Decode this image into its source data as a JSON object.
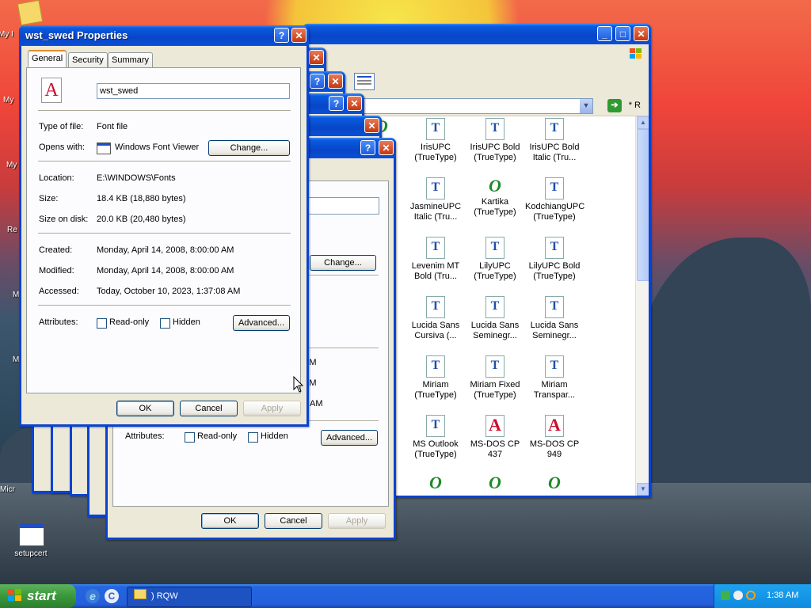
{
  "props": {
    "title": "wst_swed Properties",
    "tabs": [
      "General",
      "Security",
      "Summary"
    ],
    "filename": "wst_swed",
    "type_label": "Type of file:",
    "type_value": "Font file",
    "opens_label": "Opens with:",
    "opens_value": "Windows Font Viewer",
    "change_button": "Change...",
    "location_label": "Location:",
    "location_value": "E:\\WINDOWS\\Fonts",
    "size_label": "Size:",
    "size_value": "18.4 KB (18,880 bytes)",
    "size_disk_label": "Size on disk:",
    "size_disk_value": "20.0 KB (20,480 bytes)",
    "created_label": "Created:",
    "created_value": "Monday, April 14, 2008, 8:00:00 AM",
    "modified_label": "Modified:",
    "modified_value": "Monday, April 14, 2008, 8:00:00 AM",
    "accessed_label": "Accessed:",
    "accessed_value": "Today, October 10, 2023, 1:37:08 AM",
    "attributes_label": "Attributes:",
    "readonly_label": "Read-only",
    "hidden_label": "Hidden",
    "advanced_button": "Advanced...",
    "ok_button": "OK",
    "cancel_button": "Cancel",
    "apply_button": "Apply"
  },
  "back_dialog": {
    "change_button": "Change...",
    "attributes_label": "Attributes:",
    "readonly_label": "Read-only",
    "hidden_label": "Hidden",
    "advanced_button": "Advanced...",
    "ok_button": "OK",
    "cancel_button": "Cancel",
    "apply_button": "Apply",
    "time_suffix_1": "AM",
    "time_suffix_2": "AM",
    "time_suffix_3": "AM"
  },
  "fonts_window": {
    "address_suffix": "* R",
    "items": [
      {
        "icon": "opentype-font-icon",
        "glyph": "O",
        "label": "ect\nype)"
      },
      {
        "icon": "truetype-font-icon",
        "glyph": "T",
        "label": "IrisUPC\n(TrueType)"
      },
      {
        "icon": "truetype-font-icon",
        "glyph": "T",
        "label": "IrisUPC Bold\n(TrueType)"
      },
      {
        "icon": "truetype-font-icon",
        "glyph": "T",
        "label": "IrisUPC Bold\nItalic (Tru..."
      },
      {
        "icon": "truetype-font-icon",
        "glyph": "T",
        "label": "eUPC\nalic..."
      },
      {
        "icon": "truetype-font-icon",
        "glyph": "T",
        "label": "JasmineUPC\nItalic (Tru..."
      },
      {
        "icon": "opentype-font-icon",
        "glyph": "O",
        "label": "Kartika\n(TrueType)"
      },
      {
        "icon": "truetype-font-icon",
        "glyph": "T",
        "label": "KodchiangUPC\n(TrueType)"
      },
      {
        "icon": "truetype-font-icon",
        "glyph": "T",
        "label": "m MT\nype)"
      },
      {
        "icon": "truetype-font-icon",
        "glyph": "T",
        "label": "Levenim MT\nBold (Tru..."
      },
      {
        "icon": "truetype-font-icon",
        "glyph": "T",
        "label": "LilyUPC\n(TrueType)"
      },
      {
        "icon": "truetype-font-icon",
        "glyph": "T",
        "label": "LilyUPC Bold\n(TrueType)"
      },
      {
        "icon": "truetype-font-icon",
        "glyph": "T",
        "label": "Sans\nype)"
      },
      {
        "icon": "truetype-font-icon",
        "glyph": "T",
        "label": "Lucida Sans\nCursiva (..."
      },
      {
        "icon": "truetype-font-icon",
        "glyph": "T",
        "label": "Lucida Sans\nSeminegr..."
      },
      {
        "icon": "truetype-font-icon",
        "glyph": "T",
        "label": "Lucida Sans\nSeminegr..."
      },
      {
        "icon": "truetype-font-icon",
        "glyph": "T",
        "label": "iU &\niU..."
      },
      {
        "icon": "truetype-font-icon",
        "glyph": "T",
        "label": "Miriam\n(TrueType)"
      },
      {
        "icon": "truetype-font-icon",
        "glyph": "T",
        "label": "Miriam Fixed\n(TrueType)"
      },
      {
        "icon": "truetype-font-icon",
        "glyph": "T",
        "label": "Miriam\nTranspar..."
      },
      {
        "icon": "truetype-font-icon",
        "glyph": "T",
        "label": "cho &\nnc..."
      },
      {
        "icon": "truetype-font-icon",
        "glyph": "T",
        "label": "MS Outlook\n(TrueType)"
      },
      {
        "icon": "raster-font-icon",
        "glyph": "A",
        "label": "MS-DOS CP\n437"
      },
      {
        "icon": "raster-font-icon",
        "glyph": "A",
        "label": "MS-DOS CP\n949"
      },
      {
        "icon": "opentype-font-icon",
        "glyph": "O",
        "label": ""
      },
      {
        "icon": "opentype-font-icon",
        "glyph": "O",
        "label": ""
      },
      {
        "icon": "opentype-font-icon",
        "glyph": "O",
        "label": ""
      },
      {
        "icon": "opentype-font-icon",
        "glyph": "O",
        "label": ""
      }
    ]
  },
  "desktop": {
    "icons": [
      {
        "label": "My I"
      },
      {
        "label": "My"
      },
      {
        "label": "My"
      },
      {
        "label": "Re"
      },
      {
        "label": "M"
      },
      {
        "label": "M"
      },
      {
        "label": "Micr"
      }
    ],
    "setupcert_label": "setupcert"
  },
  "taskbar": {
    "start_label": "start",
    "task_label": ") RQW",
    "clock": "1:38 AM"
  },
  "colors": {
    "titlebar": "#0a5ae0",
    "accent_tab": "#e68b2c",
    "start": "#3c9a3c"
  }
}
